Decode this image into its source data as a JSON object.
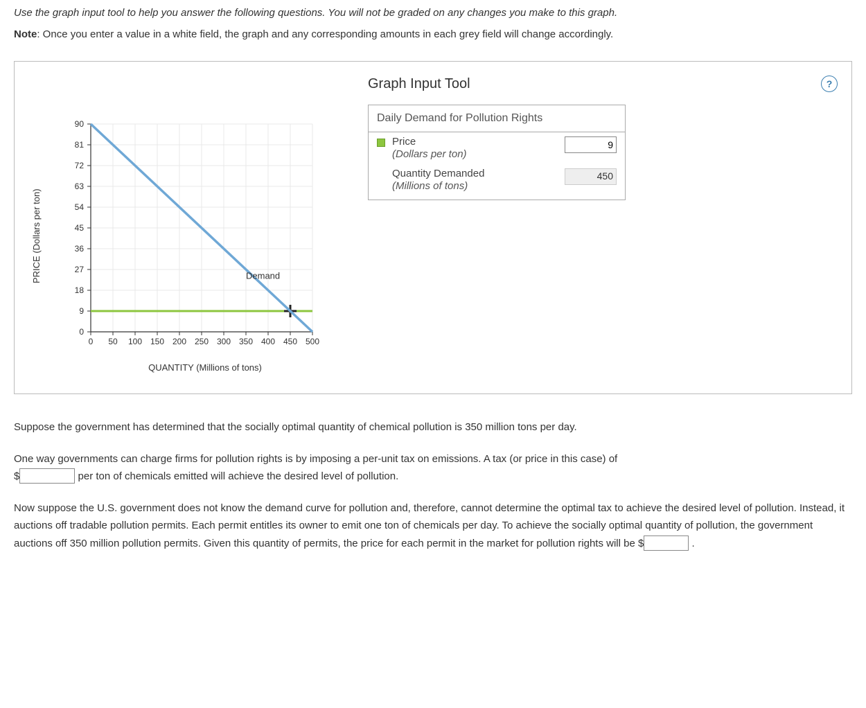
{
  "intro": "Use the graph input tool to help you answer the following questions. You will not be graded on any changes you make to this graph.",
  "note_prefix": "Note",
  "note_body": ": Once you enter a value in a white field, the graph and any corresponding amounts in each grey field will change accordingly.",
  "tool": {
    "title": "Graph Input Tool",
    "box_header": "Daily Demand for Pollution Rights",
    "price_label": "Price",
    "price_unit": "(Dollars per ton)",
    "price_value": "9",
    "qty_label": "Quantity Demanded",
    "qty_unit": "(Millions of tons)",
    "qty_value": "450"
  },
  "chart_data": {
    "type": "line",
    "title": "",
    "xlabel": "QUANTITY (Millions of tons)",
    "ylabel": "PRICE (Dollars per ton)",
    "xlim": [
      0,
      500
    ],
    "ylim": [
      0,
      90
    ],
    "x_ticks": [
      0,
      50,
      100,
      150,
      200,
      250,
      300,
      350,
      400,
      450,
      500
    ],
    "y_ticks": [
      0,
      9,
      18,
      27,
      36,
      45,
      54,
      63,
      72,
      81,
      90
    ],
    "series": [
      {
        "name": "Demand",
        "color": "#6fa8d6",
        "x": [
          0,
          500
        ],
        "y": [
          90,
          0
        ]
      }
    ],
    "indicator": {
      "price": 9,
      "quantity": 450,
      "color": "#8dc63f"
    },
    "annotations": [
      {
        "text": "Demand",
        "x": 350,
        "y": 23
      }
    ]
  },
  "q1": "Suppose the government has determined that the socially optimal quantity of chemical pollution is 350 million tons per day.",
  "q2_a": "One way governments can charge firms for pollution rights is by imposing a per-unit tax on emissions. A tax (or price in this case) of ",
  "q2_prefix": "$",
  "q2_b": " per ton of chemicals emitted will achieve the desired level of pollution.",
  "q3_a": "Now suppose the U.S. government does not know the demand curve for pollution and, therefore, cannot determine the optimal tax to achieve the desired level of pollution. Instead, it auctions off tradable pollution permits. Each permit entitles its owner to emit one ton of chemicals per day. To achieve the socially optimal quantity of pollution, the government auctions off 350 million pollution permits. Given this quantity of permits, the price for each permit in the market for pollution rights will be ",
  "q3_prefix": "$",
  "q3_b": " ."
}
